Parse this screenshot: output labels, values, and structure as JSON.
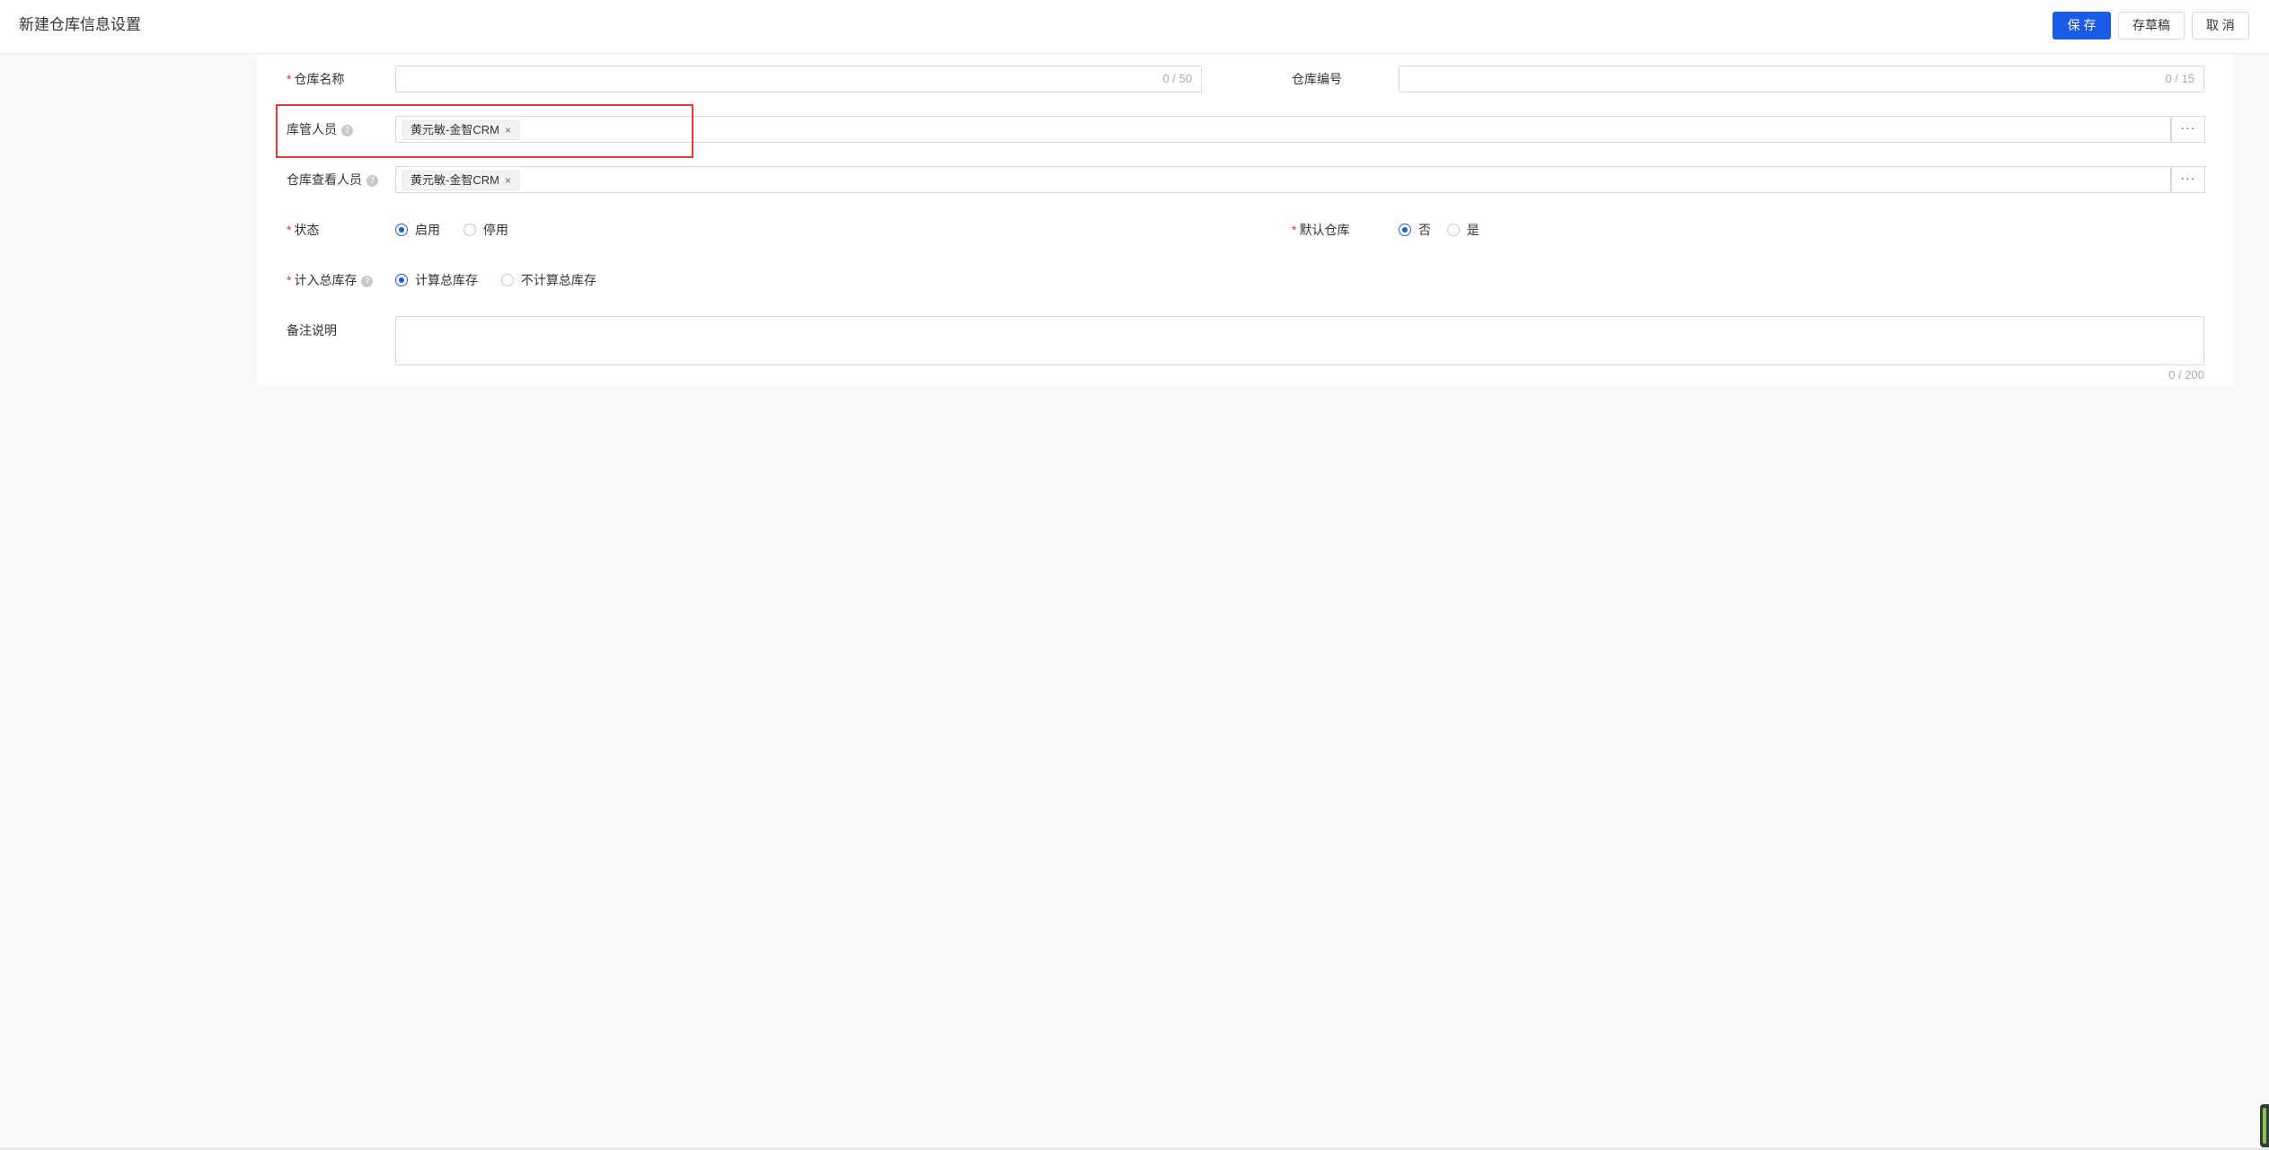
{
  "header": {
    "title": "新建仓库信息设置",
    "buttons": {
      "save": "保 存",
      "draft": "存草稿",
      "cancel": "取 消"
    }
  },
  "form": {
    "warehouse_name": {
      "label": "仓库名称",
      "value": "",
      "counter": "0 / 50"
    },
    "warehouse_code": {
      "label": "仓库编号",
      "value": "",
      "counter": "0 / 15"
    },
    "keeper": {
      "label": "库管人员",
      "tags": [
        "黄元敏-金智CRM"
      ]
    },
    "viewer": {
      "label": "仓库查看人员",
      "tags": [
        "黄元敏-金智CRM"
      ]
    },
    "status": {
      "label": "状态",
      "options": [
        "启用",
        "停用"
      ],
      "selected": "启用"
    },
    "default_warehouse": {
      "label": "默认仓库",
      "options": [
        "否",
        "是"
      ],
      "selected": "否"
    },
    "total_stock": {
      "label": "计入总库存",
      "options": [
        "计算总库存",
        "不计算总库存"
      ],
      "selected": "计算总库存"
    },
    "remark": {
      "label": "备注说明",
      "value": "",
      "counter": "0 / 200"
    }
  },
  "icons": {
    "help": "help-icon",
    "close": "close-icon",
    "more": "more-icon"
  },
  "colors": {
    "primary": "#1a5ce8",
    "required": "#e53935",
    "highlight": "#e53935"
  }
}
